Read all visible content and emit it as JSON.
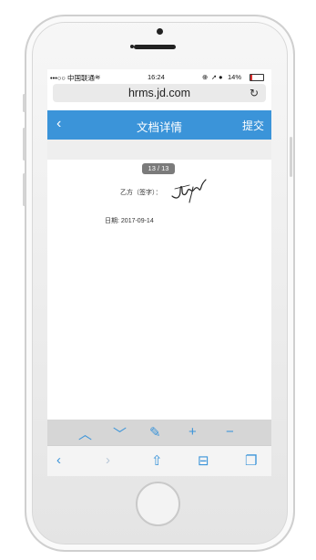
{
  "status_bar": {
    "carrier": "•••○○ 中国联通",
    "time": "16:24",
    "battery": "14%",
    "battery_fraction": 0.14
  },
  "browser": {
    "url": "hrms.jd.com"
  },
  "navbar": {
    "title": "文档详情",
    "submit_label": "提交"
  },
  "document": {
    "page_indicator": "13 / 13",
    "signature_label": "乙方（签字）：",
    "date_label": "日期:",
    "date_value": "2017-09-14"
  }
}
